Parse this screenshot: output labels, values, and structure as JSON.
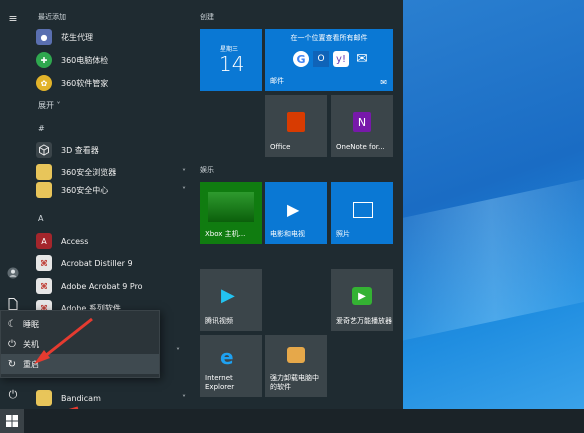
{
  "app_list": {
    "recent_header": "最近添加",
    "recent": [
      {
        "label": "花生代理",
        "icon": "peanut-proxy-icon",
        "color": "#5a6fb0"
      },
      {
        "label": "360电脑体检",
        "icon": "360-checkup-icon",
        "color": "#2fa84f"
      },
      {
        "label": "360软件管家",
        "icon": "360-software-icon",
        "color": "#e2b32a"
      }
    ],
    "expand_label": "展开",
    "hash_header": "#",
    "hash_apps": [
      {
        "label": "3D 查看器",
        "icon": "3d-viewer-icon",
        "color": "#3b454a"
      },
      {
        "label": "360安全浏览器",
        "icon": "folder-icon",
        "color": "#e8c55a"
      },
      {
        "label": "360安全中心",
        "icon": "folder-icon",
        "color": "#e8c55a"
      }
    ],
    "a_header": "A",
    "a_apps": [
      {
        "label": "Access",
        "icon": "access-icon",
        "color": "#a4262c"
      },
      {
        "label": "Acrobat Distiller 9",
        "icon": "acrobat-distiller-icon",
        "color": "#e6e6e6"
      },
      {
        "label": "Adobe Acrobat 9 Pro",
        "icon": "acrobat-pro-icon",
        "color": "#e6e6e6"
      },
      {
        "label": "Adobe 系列软件",
        "icon": "adobe-icon",
        "color": "#e6e6e6"
      }
    ],
    "bottom_app": {
      "label": "Bandicam",
      "icon": "folder-icon",
      "color": "#e8c55a"
    }
  },
  "power_menu": {
    "items": [
      {
        "label": "睡眠",
        "icon": "sleep-icon"
      },
      {
        "label": "关机",
        "icon": "power-icon"
      },
      {
        "label": "重启",
        "icon": "restart-icon"
      }
    ]
  },
  "tiles": {
    "group1": "创建",
    "calendar": {
      "day": "星期三",
      "date": "14"
    },
    "mail": {
      "header": "在一个位置查看所有邮件",
      "label": "邮件"
    },
    "office": {
      "label": "Office"
    },
    "onenote": {
      "label": "OneNote for..."
    },
    "group2": "娱乐",
    "xbox": {
      "label": "Xbox 主机..."
    },
    "movies": {
      "label": "电影和电视"
    },
    "photos": {
      "label": "照片"
    },
    "tencent_video": {
      "label": "腾讯视频"
    },
    "iqiyi": {
      "label": "爱奇艺万能播放器"
    },
    "ie": {
      "label": "Internet Explorer"
    },
    "uninstall": {
      "label": "强力卸载电脑中的软件"
    }
  }
}
